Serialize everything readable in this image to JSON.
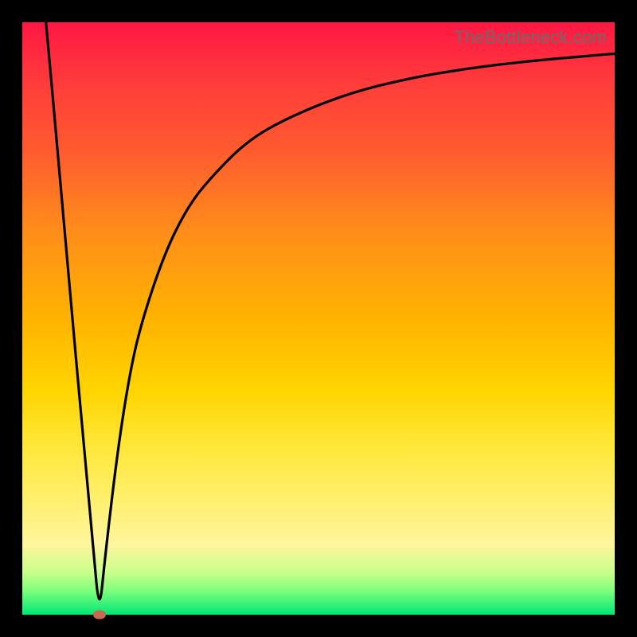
{
  "watermark": "TheBottleneck.com",
  "colors": {
    "frame": "#000000",
    "gradient_top": "#ff1744",
    "gradient_mid": "#ffd400",
    "gradient_bottom": "#00e676",
    "curve": "#000000",
    "marker": "#c7694f"
  },
  "chart_data": {
    "type": "line",
    "title": "",
    "xlabel": "",
    "ylabel": "",
    "xlim": [
      0,
      100
    ],
    "ylim": [
      0,
      100
    ],
    "grid": false,
    "legend": false,
    "notes": "Background is a vertical red→yellow→green gradient. A single black curve plunges from top-left to a minimum near x≈13 (at the bottom/green band) then rises asymptotically toward the top-right. A small brown-red marker sits at the minimum.",
    "marker": {
      "x": 13,
      "y": 0
    },
    "series": [
      {
        "name": "curve",
        "x": [
          4,
          6,
          8,
          10,
          12,
          13,
          14,
          16,
          18,
          20,
          24,
          28,
          32,
          38,
          45,
          55,
          65,
          75,
          85,
          95,
          100
        ],
        "values": [
          100,
          78,
          55,
          33,
          11,
          0,
          10,
          27,
          40,
          49,
          61,
          69,
          74,
          80,
          84,
          88,
          90.5,
          92.2,
          93.4,
          94.3,
          94.7
        ]
      }
    ]
  }
}
